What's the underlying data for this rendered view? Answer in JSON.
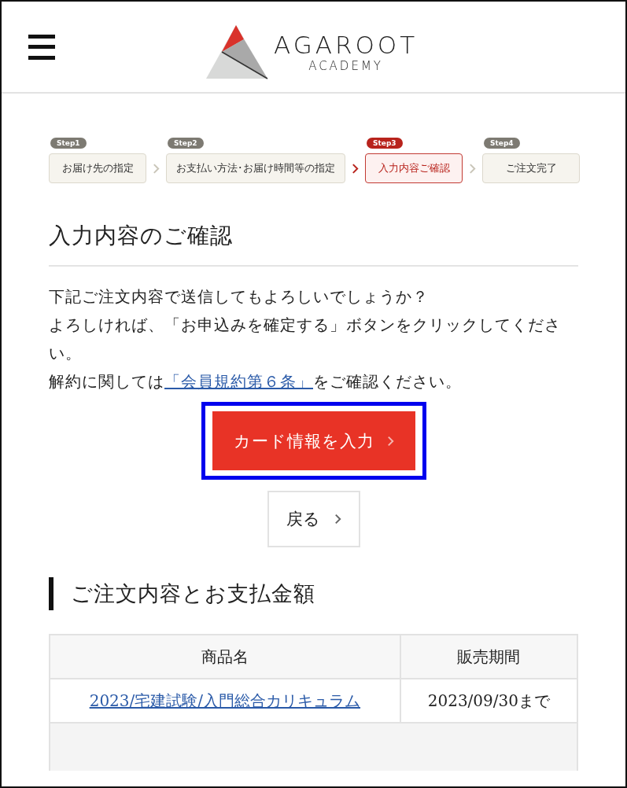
{
  "header": {
    "logo_main": "AGAROOT",
    "logo_sub": "ACADEMY"
  },
  "steps": [
    {
      "badge": "Step1",
      "label": "お届け先の指定",
      "selected": false
    },
    {
      "badge": "Step2",
      "label": "お支払い方法･お届け時間等の指定",
      "selected": false
    },
    {
      "badge": "Step3",
      "label": "入力内容ご確認",
      "selected": true
    },
    {
      "badge": "Step4",
      "label": "ご注文完了",
      "selected": false
    }
  ],
  "title": "入力内容のご確認",
  "message": [
    "下記ご注文内容で送信してもよろしいでしょうか？",
    "よろしければ、「お申込みを確定する」ボタンをクリックしてください。"
  ],
  "notice": {
    "before": "解約に関しては",
    "link": "「会員規約第６条」",
    "after": "をご確認ください。"
  },
  "primary_button": {
    "label": "カード情報を入力",
    "highlighted": true
  },
  "back_button": {
    "label": "戻る"
  },
  "order_heading": "ご注文内容とお支払金額",
  "table": {
    "columns": [
      "商品名",
      "販売期間"
    ],
    "rows": [
      {
        "product": "2023/宅建試験/入門総合カリキュラム",
        "period": "2023/09/30まで"
      }
    ]
  }
}
